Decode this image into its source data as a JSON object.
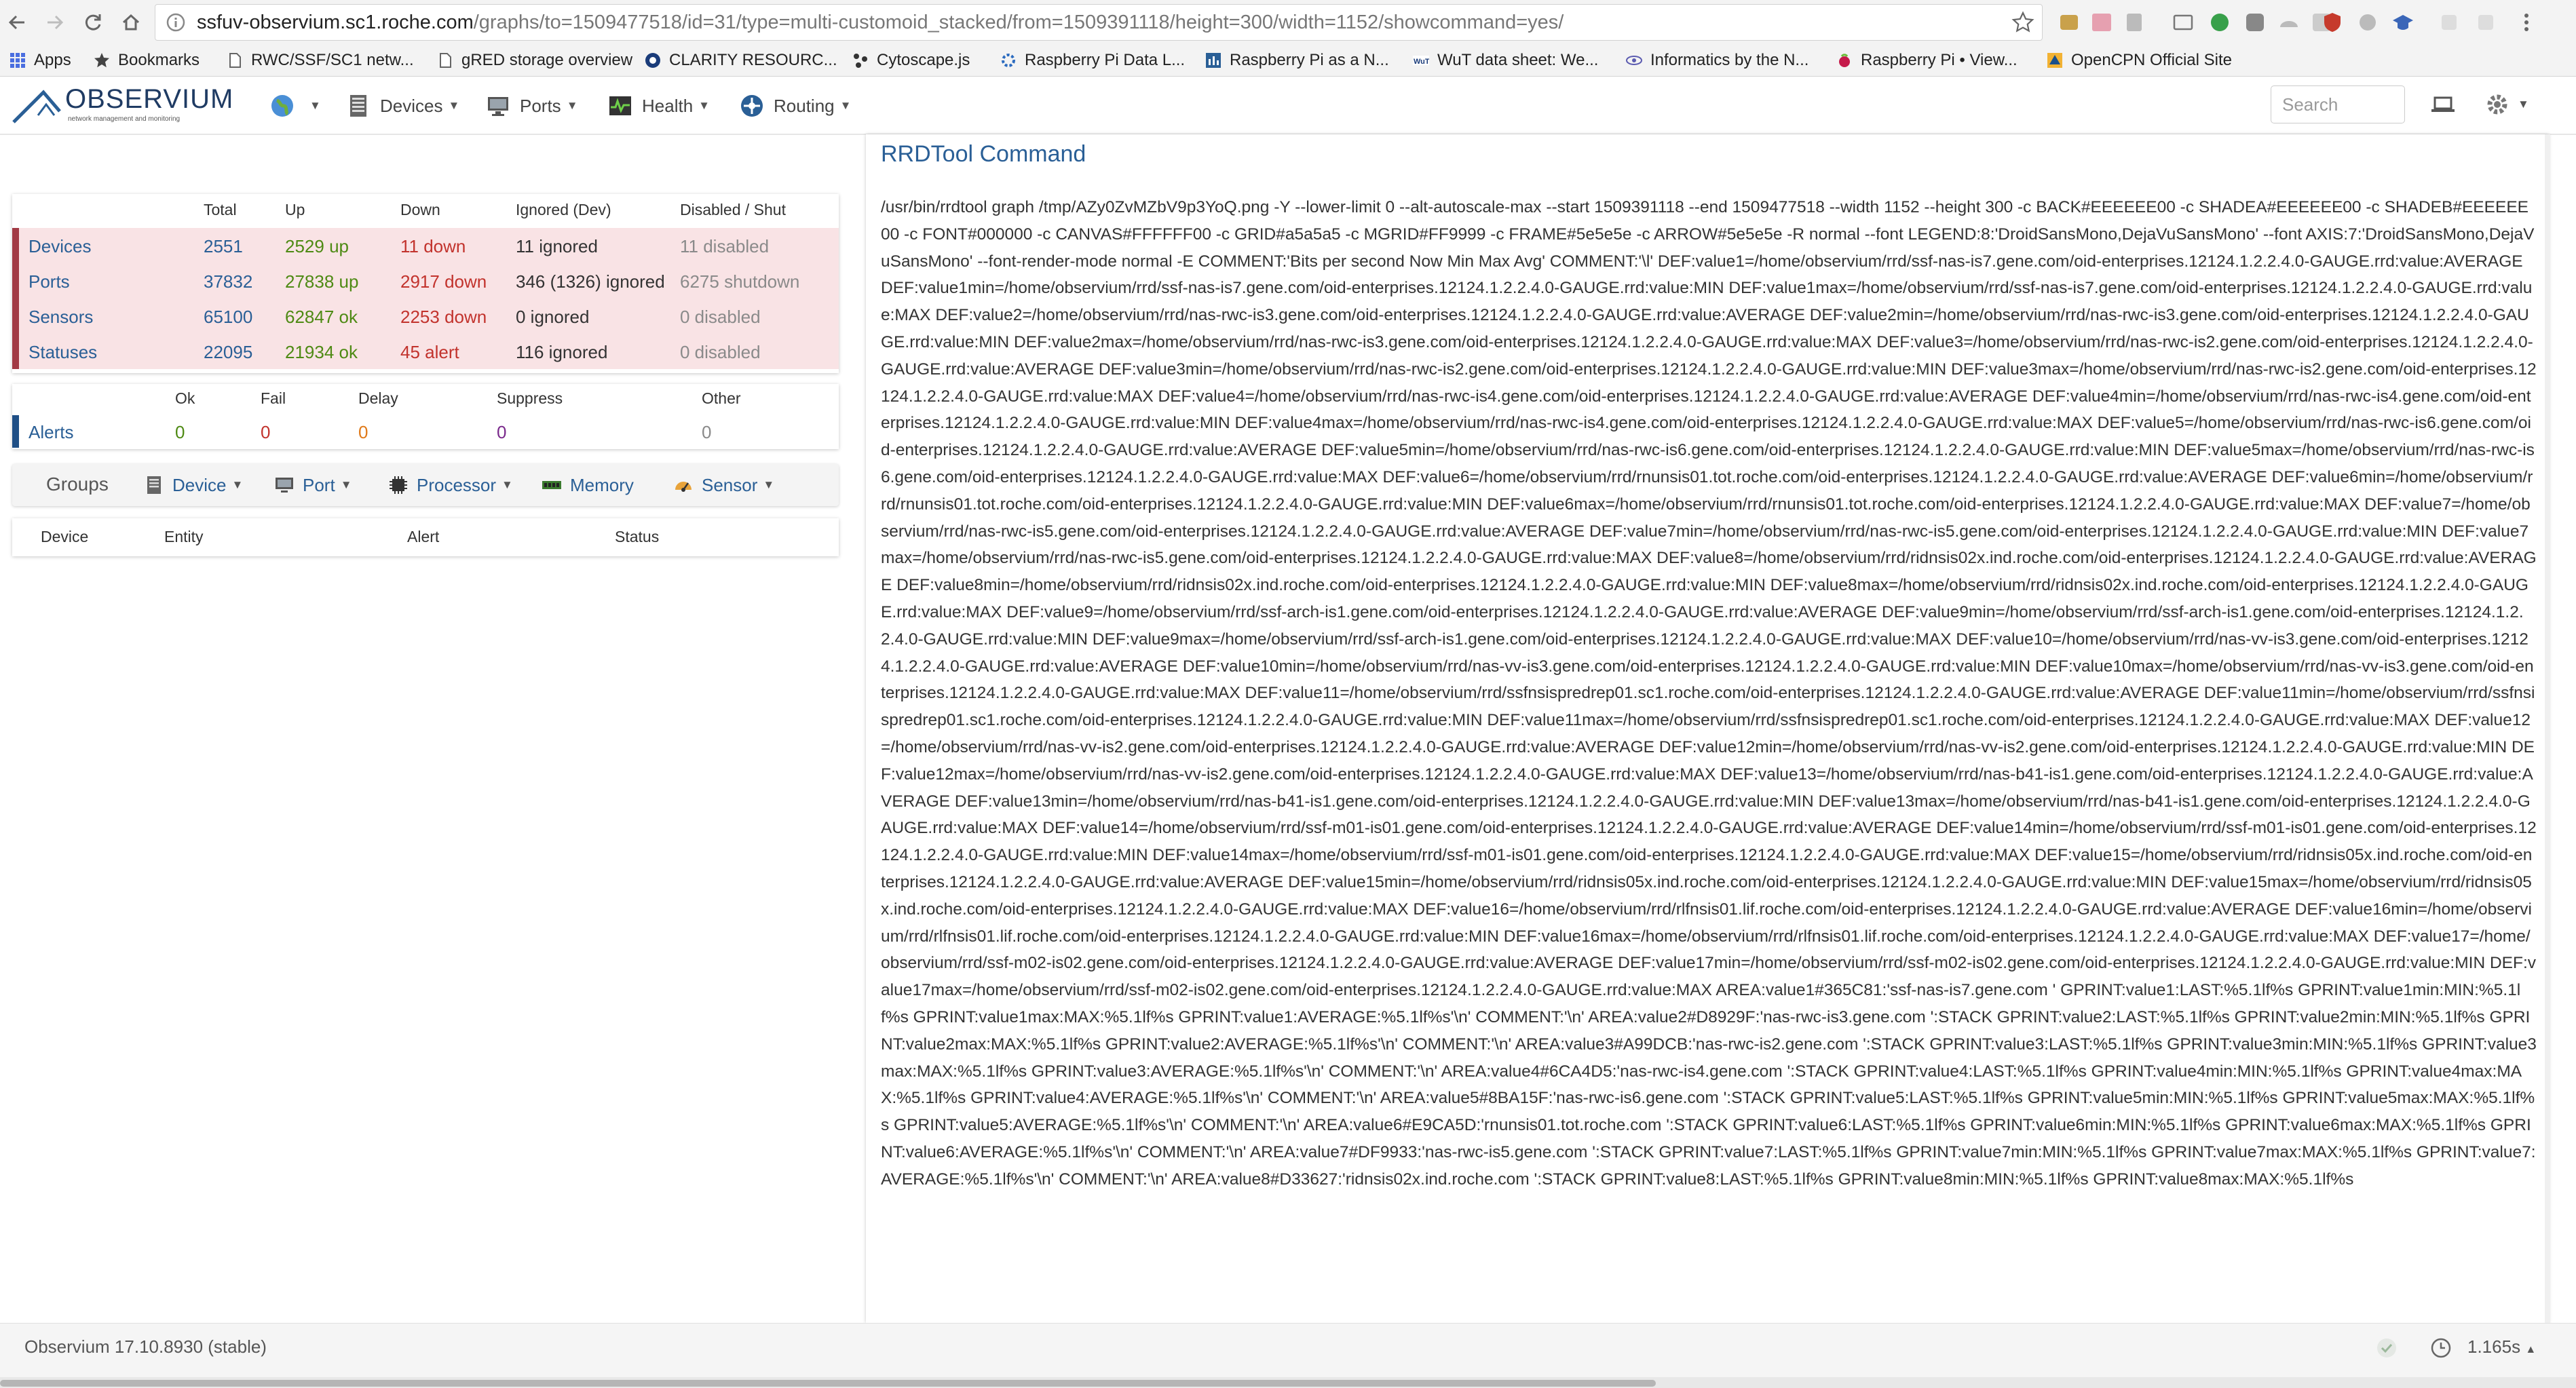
{
  "browser": {
    "url_host": "ssfuv-observium.sc1.roche.com",
    "url_path": "/graphs/to=1509477518/id=31/type=multi-customoid_stacked/from=1509391118/height=300/width=1152/showcommand=yes/",
    "bookmarks": [
      {
        "label": "Apps",
        "icon": "apps-grid-icon"
      },
      {
        "label": "Bookmarks",
        "icon": "star-icon"
      },
      {
        "label": "RWC/SSF/SC1 netw...",
        "icon": "page-icon"
      },
      {
        "label": "gRED storage overview",
        "icon": "page-icon"
      },
      {
        "label": "CLARITY RESOURC...",
        "icon": "clarity-icon"
      },
      {
        "label": "Cytoscape.js",
        "icon": "cytoscape-icon"
      },
      {
        "label": "Raspberry Pi Data L...",
        "icon": "gear-icon"
      },
      {
        "label": "Raspberry Pi as a N...",
        "icon": "chart-icon"
      },
      {
        "label": "WuT data sheet: We...",
        "icon": "wut-icon"
      },
      {
        "label": "Informatics by the N...",
        "icon": "eye-icon"
      },
      {
        "label": "Raspberry Pi • View...",
        "icon": "raspberry-icon"
      },
      {
        "label": "OpenCPN Official Site",
        "icon": "opencpn-icon"
      }
    ]
  },
  "nav": {
    "logo": "OBSERVIUM",
    "logo_sub": "network management and monitoring",
    "items": [
      {
        "label": "",
        "icon": "globe-icon"
      },
      {
        "label": "Devices",
        "icon": "server-icon"
      },
      {
        "label": "Ports",
        "icon": "monitor-icon"
      },
      {
        "label": "Health",
        "icon": "pulse-icon"
      },
      {
        "label": "Routing",
        "icon": "routing-icon"
      }
    ],
    "search_placeholder": "Search"
  },
  "summary": {
    "headers": [
      "",
      "Total",
      "Up",
      "Down",
      "Ignored (Dev)",
      "Disabled / Shut"
    ],
    "rows": [
      {
        "name": "Devices",
        "total": "2551",
        "up": "2529 up",
        "down": "11 down",
        "ignored": "11 ignored",
        "disabled": "11 disabled"
      },
      {
        "name": "Ports",
        "total": "37832",
        "up": "27838 up",
        "down": "2917 down",
        "ignored": "346 (1326) ignored",
        "disabled": "6275 shutdown"
      },
      {
        "name": "Sensors",
        "total": "65100",
        "up": "62847 ok",
        "down": "2253 down",
        "ignored": "0 ignored",
        "disabled": "0 disabled"
      },
      {
        "name": "Statuses",
        "total": "22095",
        "up": "21934 ok",
        "down": "45 alert",
        "ignored": "116 ignored",
        "disabled": "0 disabled"
      }
    ]
  },
  "alerts": {
    "headers": [
      "",
      "Ok",
      "Fail",
      "Delay",
      "Suppress",
      "Other"
    ],
    "row": {
      "name": "Alerts",
      "ok": "0",
      "fail": "0",
      "delay": "0",
      "suppress": "0",
      "other": "0"
    }
  },
  "groups": {
    "label": "Groups",
    "items": [
      {
        "label": "Device",
        "icon": "server-icon"
      },
      {
        "label": "Port",
        "icon": "monitor-icon"
      },
      {
        "label": "Processor",
        "icon": "cpu-icon"
      },
      {
        "label": "Memory",
        "icon": "memory-icon"
      },
      {
        "label": "Sensor",
        "icon": "sensor-icon"
      }
    ]
  },
  "status_table": {
    "headers": [
      "Device",
      "Entity",
      "Alert",
      "Status"
    ]
  },
  "rrd": {
    "title": "RRDTool Command",
    "command": "/usr/bin/rrdtool graph /tmp/AZy0ZvMZbV9p3YoQ.png -Y --lower-limit 0 --alt-autoscale-max --start 1509391118 --end 1509477518 --width 1152 --height 300 -c BACK#EEEEEE00 -c SHADEA#EEEEEE00 -c SHADEB#EEEEEE00 -c FONT#000000 -c CANVAS#FFFFFF00 -c GRID#a5a5a5 -c MGRID#FF9999 -c FRAME#5e5e5e -c ARROW#5e5e5e -R normal --font LEGEND:8:'DroidSansMono,DejaVuSansMono' --font AXIS:7:'DroidSansMono,DejaVuSansMono' --font-render-mode normal -E COMMENT:'Bits per second Now Min Max Avg' COMMENT:'\\l' DEF:value1=/home/observium/rrd/ssf-nas-is7.gene.com/oid-enterprises.12124.1.2.2.4.0-GAUGE.rrd:value:AVERAGE DEF:value1min=/home/observium/rrd/ssf-nas-is7.gene.com/oid-enterprises.12124.1.2.2.4.0-GAUGE.rrd:value:MIN DEF:value1max=/home/observium/rrd/ssf-nas-is7.gene.com/oid-enterprises.12124.1.2.2.4.0-GAUGE.rrd:value:MAX DEF:value2=/home/observium/rrd/nas-rwc-is3.gene.com/oid-enterprises.12124.1.2.2.4.0-GAUGE.rrd:value:AVERAGE DEF:value2min=/home/observium/rrd/nas-rwc-is3.gene.com/oid-enterprises.12124.1.2.2.4.0-GAUGE.rrd:value:MIN DEF:value2max=/home/observium/rrd/nas-rwc-is3.gene.com/oid-enterprises.12124.1.2.2.4.0-GAUGE.rrd:value:MAX DEF:value3=/home/observium/rrd/nas-rwc-is2.gene.com/oid-enterprises.12124.1.2.2.4.0-GAUGE.rrd:value:AVERAGE DEF:value3min=/home/observium/rrd/nas-rwc-is2.gene.com/oid-enterprises.12124.1.2.2.4.0-GAUGE.rrd:value:MIN DEF:value3max=/home/observium/rrd/nas-rwc-is2.gene.com/oid-enterprises.12124.1.2.2.4.0-GAUGE.rrd:value:MAX DEF:value4=/home/observium/rrd/nas-rwc-is4.gene.com/oid-enterprises.12124.1.2.2.4.0-GAUGE.rrd:value:AVERAGE DEF:value4min=/home/observium/rrd/nas-rwc-is4.gene.com/oid-enterprises.12124.1.2.2.4.0-GAUGE.rrd:value:MIN DEF:value4max=/home/observium/rrd/nas-rwc-is4.gene.com/oid-enterprises.12124.1.2.2.4.0-GAUGE.rrd:value:MAX DEF:value5=/home/observium/rrd/nas-rwc-is6.gene.com/oid-enterprises.12124.1.2.2.4.0-GAUGE.rrd:value:AVERAGE DEF:value5min=/home/observium/rrd/nas-rwc-is6.gene.com/oid-enterprises.12124.1.2.2.4.0-GAUGE.rrd:value:MIN DEF:value5max=/home/observium/rrd/nas-rwc-is6.gene.com/oid-enterprises.12124.1.2.2.4.0-GAUGE.rrd:value:MAX DEF:value6=/home/observium/rrd/rnunsis01.tot.roche.com/oid-enterprises.12124.1.2.2.4.0-GAUGE.rrd:value:AVERAGE DEF:value6min=/home/observium/rrd/rnunsis01.tot.roche.com/oid-enterprises.12124.1.2.2.4.0-GAUGE.rrd:value:MIN DEF:value6max=/home/observium/rrd/rnunsis01.tot.roche.com/oid-enterprises.12124.1.2.2.4.0-GAUGE.rrd:value:MAX DEF:value7=/home/observium/rrd/nas-rwc-is5.gene.com/oid-enterprises.12124.1.2.2.4.0-GAUGE.rrd:value:AVERAGE DEF:value7min=/home/observium/rrd/nas-rwc-is5.gene.com/oid-enterprises.12124.1.2.2.4.0-GAUGE.rrd:value:MIN DEF:value7max=/home/observium/rrd/nas-rwc-is5.gene.com/oid-enterprises.12124.1.2.2.4.0-GAUGE.rrd:value:MAX DEF:value8=/home/observium/rrd/ridnsis02x.ind.roche.com/oid-enterprises.12124.1.2.2.4.0-GAUGE.rrd:value:AVERAGE DEF:value8min=/home/observium/rrd/ridnsis02x.ind.roche.com/oid-enterprises.12124.1.2.2.4.0-GAUGE.rrd:value:MIN DEF:value8max=/home/observium/rrd/ridnsis02x.ind.roche.com/oid-enterprises.12124.1.2.2.4.0-GAUGE.rrd:value:MAX DEF:value9=/home/observium/rrd/ssf-arch-is1.gene.com/oid-enterprises.12124.1.2.2.4.0-GAUGE.rrd:value:AVERAGE DEF:value9min=/home/observium/rrd/ssf-arch-is1.gene.com/oid-enterprises.12124.1.2.2.4.0-GAUGE.rrd:value:MIN DEF:value9max=/home/observium/rrd/ssf-arch-is1.gene.com/oid-enterprises.12124.1.2.2.4.0-GAUGE.rrd:value:MAX DEF:value10=/home/observium/rrd/nas-vv-is3.gene.com/oid-enterprises.12124.1.2.2.4.0-GAUGE.rrd:value:AVERAGE DEF:value10min=/home/observium/rrd/nas-vv-is3.gene.com/oid-enterprises.12124.1.2.2.4.0-GAUGE.rrd:value:MIN DEF:value10max=/home/observium/rrd/nas-vv-is3.gene.com/oid-enterprises.12124.1.2.2.4.0-GAUGE.rrd:value:MAX DEF:value11=/home/observium/rrd/ssfnsispredrep01.sc1.roche.com/oid-enterprises.12124.1.2.2.4.0-GAUGE.rrd:value:AVERAGE DEF:value11min=/home/observium/rrd/ssfnsispredrep01.sc1.roche.com/oid-enterprises.12124.1.2.2.4.0-GAUGE.rrd:value:MIN DEF:value11max=/home/observium/rrd/ssfnsispredrep01.sc1.roche.com/oid-enterprises.12124.1.2.2.4.0-GAUGE.rrd:value:MAX DEF:value12=/home/observium/rrd/nas-vv-is2.gene.com/oid-enterprises.12124.1.2.2.4.0-GAUGE.rrd:value:AVERAGE DEF:value12min=/home/observium/rrd/nas-vv-is2.gene.com/oid-enterprises.12124.1.2.2.4.0-GAUGE.rrd:value:MIN DEF:value12max=/home/observium/rrd/nas-vv-is2.gene.com/oid-enterprises.12124.1.2.2.4.0-GAUGE.rrd:value:MAX DEF:value13=/home/observium/rrd/nas-b41-is1.gene.com/oid-enterprises.12124.1.2.2.4.0-GAUGE.rrd:value:AVERAGE DEF:value13min=/home/observium/rrd/nas-b41-is1.gene.com/oid-enterprises.12124.1.2.2.4.0-GAUGE.rrd:value:MIN DEF:value13max=/home/observium/rrd/nas-b41-is1.gene.com/oid-enterprises.12124.1.2.2.4.0-GAUGE.rrd:value:MAX DEF:value14=/home/observium/rrd/ssf-m01-is01.gene.com/oid-enterprises.12124.1.2.2.4.0-GAUGE.rrd:value:AVERAGE DEF:value14min=/home/observium/rrd/ssf-m01-is01.gene.com/oid-enterprises.12124.1.2.2.4.0-GAUGE.rrd:value:MIN DEF:value14max=/home/observium/rrd/ssf-m01-is01.gene.com/oid-enterprises.12124.1.2.2.4.0-GAUGE.rrd:value:MAX DEF:value15=/home/observium/rrd/ridnsis05x.ind.roche.com/oid-enterprises.12124.1.2.2.4.0-GAUGE.rrd:value:AVERAGE DEF:value15min=/home/observium/rrd/ridnsis05x.ind.roche.com/oid-enterprises.12124.1.2.2.4.0-GAUGE.rrd:value:MIN DEF:value15max=/home/observium/rrd/ridnsis05x.ind.roche.com/oid-enterprises.12124.1.2.2.4.0-GAUGE.rrd:value:MAX DEF:value16=/home/observium/rrd/rlfnsis01.lif.roche.com/oid-enterprises.12124.1.2.2.4.0-GAUGE.rrd:value:AVERAGE DEF:value16min=/home/observium/rrd/rlfnsis01.lif.roche.com/oid-enterprises.12124.1.2.2.4.0-GAUGE.rrd:value:MIN DEF:value16max=/home/observium/rrd/rlfnsis01.lif.roche.com/oid-enterprises.12124.1.2.2.4.0-GAUGE.rrd:value:MAX DEF:value17=/home/observium/rrd/ssf-m02-is02.gene.com/oid-enterprises.12124.1.2.2.4.0-GAUGE.rrd:value:AVERAGE DEF:value17min=/home/observium/rrd/ssf-m02-is02.gene.com/oid-enterprises.12124.1.2.2.4.0-GAUGE.rrd:value:MIN DEF:value17max=/home/observium/rrd/ssf-m02-is02.gene.com/oid-enterprises.12124.1.2.2.4.0-GAUGE.rrd:value:MAX AREA:value1#365C81:'ssf-nas-is7.gene.com ' GPRINT:value1:LAST:%5.1lf%s GPRINT:value1min:MIN:%5.1lf%s GPRINT:value1max:MAX:%5.1lf%s GPRINT:value1:AVERAGE:%5.1lf%s'\\n' COMMENT:'\\n' AREA:value2#D8929F:'nas-rwc-is3.gene.com ':STACK GPRINT:value2:LAST:%5.1lf%s GPRINT:value2min:MIN:%5.1lf%s GPRINT:value2max:MAX:%5.1lf%s GPRINT:value2:AVERAGE:%5.1lf%s'\\n' COMMENT:'\\n' AREA:value3#A99DCB:'nas-rwc-is2.gene.com ':STACK GPRINT:value3:LAST:%5.1lf%s GPRINT:value3min:MIN:%5.1lf%s GPRINT:value3max:MAX:%5.1lf%s GPRINT:value3:AVERAGE:%5.1lf%s'\\n' COMMENT:'\\n' AREA:value4#6CA4D5:'nas-rwc-is4.gene.com ':STACK GPRINT:value4:LAST:%5.1lf%s GPRINT:value4min:MIN:%5.1lf%s GPRINT:value4max:MAX:%5.1lf%s GPRINT:value4:AVERAGE:%5.1lf%s'\\n' COMMENT:'\\n' AREA:value5#8BA15F:'nas-rwc-is6.gene.com ':STACK GPRINT:value5:LAST:%5.1lf%s GPRINT:value5min:MIN:%5.1lf%s GPRINT:value5max:MAX:%5.1lf%s GPRINT:value5:AVERAGE:%5.1lf%s'\\n' COMMENT:'\\n' AREA:value6#E9CA5D:'rnunsis01.tot.roche.com ':STACK GPRINT:value6:LAST:%5.1lf%s GPRINT:value6min:MIN:%5.1lf%s GPRINT:value6max:MAX:%5.1lf%s GPRINT:value6:AVERAGE:%5.1lf%s'\\n' COMMENT:'\\n' AREA:value7#DF9933:'nas-rwc-is5.gene.com ':STACK GPRINT:value7:LAST:%5.1lf%s GPRINT:value7min:MIN:%5.1lf%s GPRINT:value7max:MAX:%5.1lf%s GPRINT:value7:AVERAGE:%5.1lf%s'\\n' COMMENT:'\\n' AREA:value8#D33627:'ridnsis02x.ind.roche.com ':STACK GPRINT:value8:LAST:%5.1lf%s GPRINT:value8min:MIN:%5.1lf%s GPRINT:value8max:MAX:%5.1lf%s"
  },
  "footer": {
    "version": "Observium 17.10.8930 (stable)",
    "exec_time": "1.165s"
  },
  "colors": {
    "link": "#2a5f96",
    "up": "#4e8a14",
    "down": "#c2332d",
    "row_bg": "#f9e3e5",
    "row_marker": "#a23a45",
    "alerts_marker": "#1f4f86"
  }
}
